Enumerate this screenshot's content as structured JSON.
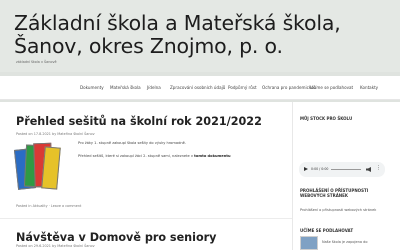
{
  "site": {
    "title": "Základní škola a Mateřská škola, Šanov, okres Znojmo, p. o.",
    "tagline": "základní škola v Šanově"
  },
  "nav": {
    "items": [
      "Dokumenty",
      "Mateřská škola",
      "Jídelna",
      "Zpracování osobních údajů",
      "Podpůrný růst",
      "Ochrana pro pandemickou",
      "Učíme se podlahovat",
      "Kontakty"
    ]
  },
  "posts": [
    {
      "title": "Přehled sešitů na školní rok 2021/2022",
      "meta": "Posted on 17.8.2021 by Mateřina školní Šanov",
      "text": [
        "Pro žáky 1. stupně zakoupí škola sešity do výuky hromadně.",
        "Přehled sešitů, které si zakoupí žáci 2. stupně sami, naleznete v",
        "tomto dokumentu"
      ],
      "footer": "Posted in Aktuality · Leave a comment"
    },
    {
      "title": "Návštěva v Domově pro seniory",
      "meta": "Posted on 29.6.2021 by Mateřina školní Šanov"
    }
  ],
  "sidebar": {
    "school_widget_title": "MŮJ STOCK PRO ŠKOLU",
    "player": {
      "time": "0:00 / 0:00"
    },
    "accessibility_title": "PROHLÁŠENÍ O PŘÍSTUPNOSTI WEBOVÝCH STRÁNEK",
    "accessibility_text": "Prohlášení o přístupnosti webových stránek",
    "learn_title": "UČÍME SE PODLAHOVAT",
    "learn_text": "Naše škola je zapojena do"
  },
  "colors": {
    "header_bg": "#e4e8e4",
    "page_bg": "#dfe3df",
    "content_bg": "#ffffff"
  }
}
